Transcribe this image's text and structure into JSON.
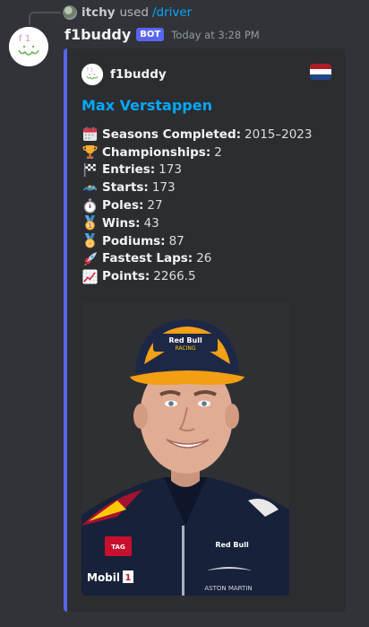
{
  "reply": {
    "user": "itchy",
    "used_text": "used",
    "command": "/driver"
  },
  "message": {
    "author": "f1buddy",
    "bot_tag": "BOT",
    "timestamp": "Today at 3:28 PM"
  },
  "embed": {
    "accent_color": "#5865f2",
    "author": "f1buddy",
    "flag_colors": [
      "#ae1c28",
      "#ffffff",
      "#21468b"
    ],
    "title": "Max Verstappen",
    "fields": [
      {
        "icon": "calendar-icon",
        "label": "Seasons Completed:",
        "value": "2015–2023"
      },
      {
        "icon": "trophy-icon",
        "label": "Championships:",
        "value": "2"
      },
      {
        "icon": "chequered-flag-icon",
        "label": "Entries:",
        "value": "173"
      },
      {
        "icon": "race-car-icon",
        "label": "Starts:",
        "value": "173"
      },
      {
        "icon": "stopwatch-icon",
        "label": "Poles:",
        "value": "27"
      },
      {
        "icon": "first-place-medal-icon",
        "label": "Wins:",
        "value": "43"
      },
      {
        "icon": "medal-icon",
        "label": "Podiums:",
        "value": "87"
      },
      {
        "icon": "rocket-icon",
        "label": "Fastest Laps:",
        "value": "26"
      },
      {
        "icon": "chart-increasing-icon",
        "label": "Points:",
        "value": "2266.5"
      }
    ],
    "image": {
      "cap_text": "Red Bull RACING",
      "sponsor_tag": "TAG Heuer",
      "sponsor_mobil": "Mobil 1",
      "sponsor_aston": "ASTON MARTIN"
    }
  }
}
